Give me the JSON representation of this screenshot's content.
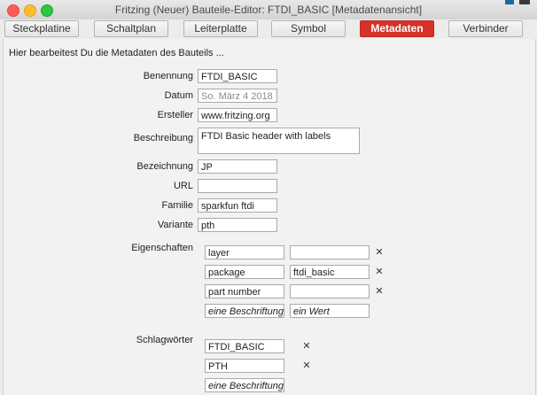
{
  "window": {
    "title": "Fritzing (Neuer) Bauteile-Editor: FTDI_BASIC [Metadatenansicht]"
  },
  "tabs": [
    {
      "label": "Steckplatine"
    },
    {
      "label": "Schaltplan"
    },
    {
      "label": "Leiterplatte"
    },
    {
      "label": "Symbol"
    },
    {
      "label": "Metadaten",
      "active": true
    },
    {
      "label": "Verbinder"
    }
  ],
  "intro": "Hier bearbeitest Du die Metadaten des Bauteils ...",
  "fields": {
    "benennung": {
      "label": "Benennung",
      "value": "FTDI_BASIC"
    },
    "datum": {
      "label": "Datum",
      "value": "So. März 4 2018"
    },
    "ersteller": {
      "label": "Ersteller",
      "value": "www.fritzing.org"
    },
    "beschreibung": {
      "label": "Beschreibung",
      "value": "FTDI Basic header with labels"
    },
    "bezeichnung": {
      "label": "Bezeichnung",
      "value": "JP"
    },
    "url": {
      "label": "URL",
      "value": ""
    },
    "familie": {
      "label": "Familie",
      "value": "sparkfun ftdi"
    },
    "variante": {
      "label": "Variante",
      "value": "pth"
    }
  },
  "eigenschaften": {
    "label": "Eigenschaften",
    "rows": [
      {
        "name": "layer",
        "value": ""
      },
      {
        "name": "package",
        "value": "ftdi_basic"
      },
      {
        "name": "part number",
        "value": ""
      }
    ],
    "new_name_placeholder": "eine Beschriftung",
    "new_value_placeholder": "ein Wert"
  },
  "schlagwoerter": {
    "label": "Schlagwörter",
    "tags": [
      "FTDI_BASIC",
      "PTH"
    ],
    "new_placeholder": "eine Beschriftung"
  },
  "remove_glyph": "✕",
  "colors": {
    "active_tab": "#d6322a",
    "close": "#fc5f57",
    "minimize": "#fdbc2e",
    "zoom": "#28c840"
  }
}
